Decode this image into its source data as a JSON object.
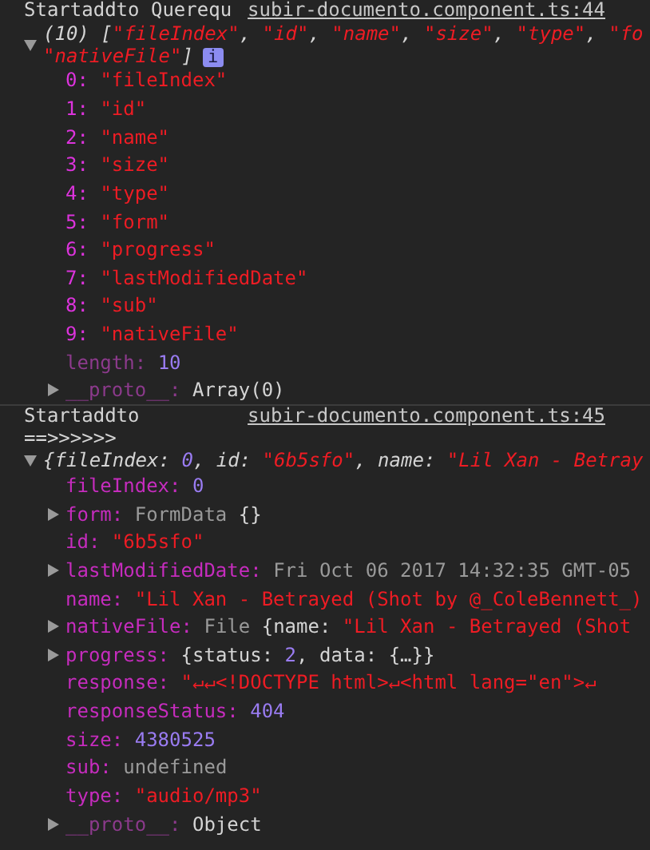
{
  "messages": [
    {
      "text_lines": [
        "Startaddto Querequ"
      ],
      "source": "subir-documento.component.ts:44",
      "expanded": true,
      "info_badge": "i",
      "summary": [
        [
          {
            "kind": "plain",
            "text": "(10) ["
          },
          {
            "kind": "string",
            "text": "\"fileIndex\""
          },
          {
            "kind": "plain",
            "text": ", "
          },
          {
            "kind": "string",
            "text": "\"id\""
          },
          {
            "kind": "plain",
            "text": ", "
          },
          {
            "kind": "string",
            "text": "\"name\""
          },
          {
            "kind": "plain",
            "text": ", "
          },
          {
            "kind": "string",
            "text": "\"size\""
          },
          {
            "kind": "plain",
            "text": ", "
          },
          {
            "kind": "string",
            "text": "\"type\""
          },
          {
            "kind": "plain",
            "text": ", "
          },
          {
            "kind": "string",
            "text": "\"fo"
          }
        ],
        [
          {
            "kind": "string",
            "text": "\"nativeFile\""
          },
          {
            "kind": "plain",
            "text": "]"
          }
        ]
      ],
      "properties": [
        {
          "key": "0:",
          "kind": "index",
          "value": [
            {
              "kind": "string",
              "text": "\"fileIndex\""
            }
          ]
        },
        {
          "key": "1:",
          "kind": "index",
          "value": [
            {
              "kind": "string",
              "text": "\"id\""
            }
          ]
        },
        {
          "key": "2:",
          "kind": "index",
          "value": [
            {
              "kind": "string",
              "text": "\"name\""
            }
          ]
        },
        {
          "key": "3:",
          "kind": "index",
          "value": [
            {
              "kind": "string",
              "text": "\"size\""
            }
          ]
        },
        {
          "key": "4:",
          "kind": "index",
          "value": [
            {
              "kind": "string",
              "text": "\"type\""
            }
          ]
        },
        {
          "key": "5:",
          "kind": "index",
          "value": [
            {
              "kind": "string",
              "text": "\"form\""
            }
          ]
        },
        {
          "key": "6:",
          "kind": "index",
          "value": [
            {
              "kind": "string",
              "text": "\"progress\""
            }
          ]
        },
        {
          "key": "7:",
          "kind": "index",
          "value": [
            {
              "kind": "string",
              "text": "\"lastModifiedDate\""
            }
          ]
        },
        {
          "key": "8:",
          "kind": "index",
          "value": [
            {
              "kind": "string",
              "text": "\"sub\""
            }
          ]
        },
        {
          "key": "9:",
          "kind": "index",
          "value": [
            {
              "kind": "string",
              "text": "\"nativeFile\""
            }
          ]
        },
        {
          "key": "length:",
          "kind": "internal",
          "value": [
            {
              "kind": "number",
              "text": "10"
            }
          ]
        },
        {
          "key": "__proto__:",
          "kind": "internal",
          "expanded": false,
          "value": [
            {
              "kind": "plain",
              "text": "Array(0)"
            }
          ]
        }
      ]
    },
    {
      "text_lines": [
        "Startaddto",
        "==>>>>>>"
      ],
      "source": "subir-documento.component.ts:45",
      "expanded": true,
      "summary": [
        [
          {
            "kind": "plain",
            "text": "{fileIndex: "
          },
          {
            "kind": "number",
            "text": "0"
          },
          {
            "kind": "plain",
            "text": ", id: "
          },
          {
            "kind": "string",
            "text": "\"6b5sfo\""
          },
          {
            "kind": "plain",
            "text": ", name: "
          },
          {
            "kind": "string",
            "text": "\"Lil Xan - Betray"
          }
        ]
      ],
      "properties": [
        {
          "key": "fileIndex:",
          "kind": "own",
          "value": [
            {
              "kind": "number",
              "text": "0"
            }
          ]
        },
        {
          "key": "form:",
          "kind": "own",
          "expanded": false,
          "value": [
            {
              "kind": "dim",
              "text": "FormData "
            },
            {
              "kind": "plain",
              "text": "{}"
            }
          ]
        },
        {
          "key": "id:",
          "kind": "own",
          "value": [
            {
              "kind": "string",
              "text": "\"6b5sfo\""
            }
          ]
        },
        {
          "key": "lastModifiedDate:",
          "kind": "own",
          "expanded": false,
          "value": [
            {
              "kind": "dim",
              "text": "Fri Oct 06 2017 14:32:35 GMT-05"
            }
          ]
        },
        {
          "key": "name:",
          "kind": "own",
          "value": [
            {
              "kind": "string",
              "text": "\"Lil Xan - Betrayed (Shot by @_ColeBennett_)"
            }
          ]
        },
        {
          "key": "nativeFile:",
          "kind": "own",
          "expanded": false,
          "value": [
            {
              "kind": "dim",
              "text": "File "
            },
            {
              "kind": "plain",
              "text": "{name: "
            },
            {
              "kind": "string",
              "text": "\"Lil Xan - Betrayed (Shot"
            }
          ]
        },
        {
          "key": "progress:",
          "kind": "own",
          "expanded": false,
          "value": [
            {
              "kind": "plain",
              "text": "{status: "
            },
            {
              "kind": "number",
              "text": "2"
            },
            {
              "kind": "plain",
              "text": ", data: {…}}"
            }
          ]
        },
        {
          "key": "response:",
          "kind": "own",
          "value": [
            {
              "kind": "string",
              "text": "\"↵↵<!DOCTYPE html>↵<html lang=\"en\">↵"
            }
          ]
        },
        {
          "key": "responseStatus:",
          "kind": "own",
          "value": [
            {
              "kind": "number",
              "text": "404"
            }
          ]
        },
        {
          "key": "size:",
          "kind": "own",
          "value": [
            {
              "kind": "number",
              "text": "4380525"
            }
          ]
        },
        {
          "key": "sub:",
          "kind": "own",
          "value": [
            {
              "kind": "dim",
              "text": "undefined"
            }
          ]
        },
        {
          "key": "type:",
          "kind": "own",
          "value": [
            {
              "kind": "string",
              "text": "\"audio/mp3\""
            }
          ]
        },
        {
          "key": "__proto__:",
          "kind": "internal",
          "expanded": false,
          "value": [
            {
              "kind": "plain",
              "text": "Object"
            }
          ]
        }
      ]
    }
  ]
}
